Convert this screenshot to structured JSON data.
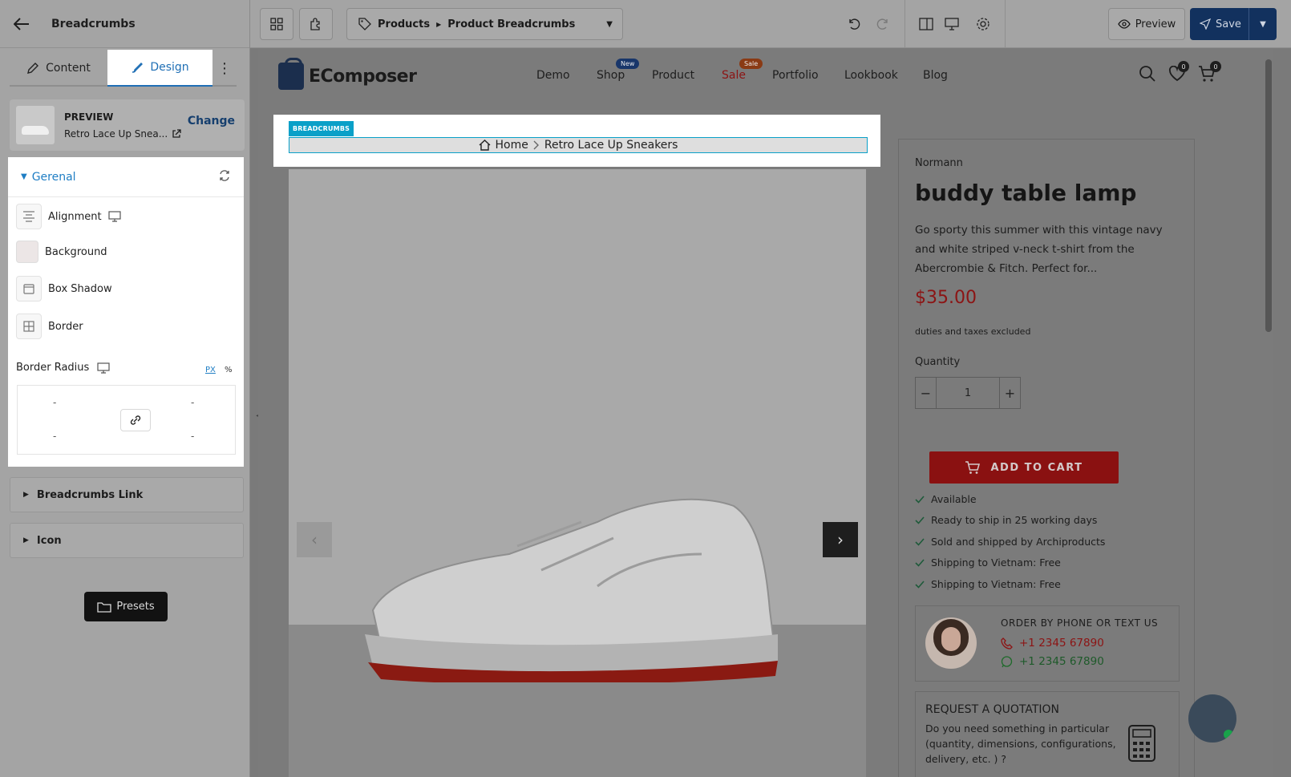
{
  "panel": {
    "title": "Breadcrumbs",
    "tabs": [
      {
        "label": "Content"
      },
      {
        "label": "Design"
      }
    ],
    "preview": {
      "label": "PREVIEW",
      "product": "Retro Lace Up Snea...",
      "change": "Change"
    },
    "general": {
      "title": "Gerenal",
      "rows": [
        {
          "label": "Alignment"
        },
        {
          "label": "Background"
        },
        {
          "label": "Box Shadow"
        },
        {
          "label": "Border"
        }
      ],
      "border_radius": {
        "label": "Border Radius",
        "unit_px": "PX",
        "unit_pct": "%",
        "values": [
          "-",
          "-",
          "-",
          "-"
        ]
      }
    },
    "accordions": [
      {
        "label": "Breadcrumbs Link"
      },
      {
        "label": "Icon"
      }
    ],
    "presets": "Presets"
  },
  "toolbar": {
    "breadcrumb": [
      "Products",
      "Product Breadcrumbs"
    ],
    "preview": "Preview",
    "save": "Save"
  },
  "store": {
    "logo": "EComposer",
    "nav": [
      {
        "label": "Demo"
      },
      {
        "label": "Shop",
        "badge": "New"
      },
      {
        "label": "Product"
      },
      {
        "label": "Sale",
        "badge": "Sale"
      },
      {
        "label": "Portfolio"
      },
      {
        "label": "Lookbook"
      },
      {
        "label": "Blog"
      }
    ],
    "wishlist_count": "0",
    "cart_count": "0"
  },
  "breadcrumbs": {
    "tag": "BREADCRUMBS",
    "home": "Home",
    "current": "Retro Lace Up Sneakers"
  },
  "product": {
    "vendor": "Normann",
    "title": "buddy table lamp",
    "description": "Go sporty this summer with this vintage navy and white striped v-neck t-shirt from the Abercrombie & Fitch. Perfect for...",
    "price": "$35.00",
    "tax_note": "duties and taxes excluded",
    "quantity_label": "Quantity",
    "quantity": "1",
    "add_to_cart": "ADD TO CART",
    "features": [
      "Available",
      "Ready to ship in 25 working days",
      "Sold and shipped by Archiproducts",
      "Shipping to Vietnam: Free",
      "Shipping to Vietnam: Free"
    ],
    "order": {
      "title": "ORDER BY PHONE OR TEXT US",
      "phone": "+1 2345 67890",
      "whatsapp": "+1 2345 67890"
    },
    "quote": {
      "title": "REQUEST A QUOTATION",
      "text": "Do you need something in particular (quantity, dimensions, configurations, delivery, etc. ) ?"
    }
  },
  "colors": {
    "accent": "#1f7ec4",
    "save": "#12315e",
    "breadcrumb_tag": "#0aa0c8",
    "price": "#8c1414",
    "add_to_cart": "#8a1111"
  }
}
